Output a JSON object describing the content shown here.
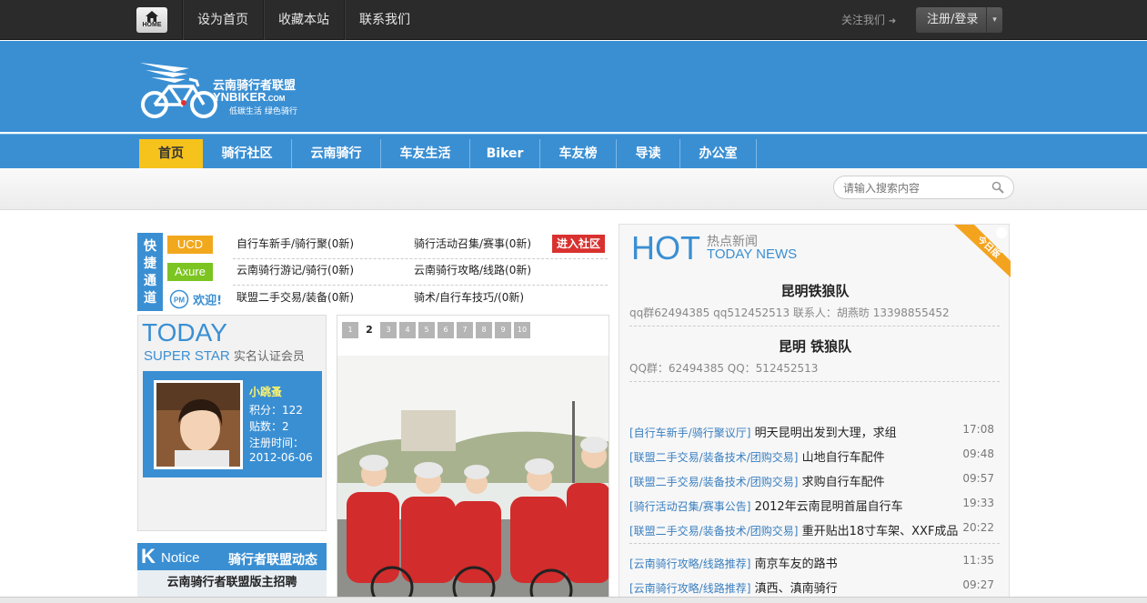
{
  "topbar": {
    "home_label": "HOME",
    "links": [
      "设为首页",
      "收藏本站",
      "联系我们"
    ],
    "follow": "关注我们",
    "login": "注册/登录"
  },
  "logo": {
    "cn": "云南骑行者联盟",
    "en": "YNBIKER",
    "en_suffix": ".COM",
    "slogan": "低碳生活 绿色骑行"
  },
  "nav": [
    "首页",
    "骑行社区",
    "云南骑行",
    "车友生活",
    "Biker",
    "车友榜",
    "导读",
    "办公室"
  ],
  "search": {
    "placeholder": "请输入搜索内容"
  },
  "quick": {
    "label_chars": [
      "快",
      "捷",
      "通",
      "道"
    ],
    "tags": [
      "UCD",
      "Axure"
    ],
    "pm": "欢迎!",
    "links": [
      "自行车新手/骑行聚(0新)",
      "骑行活动召集/赛事(0新)",
      "云南骑行游记/骑行(0新)",
      "云南骑行攻略/线路(0新)",
      "联盟二手交易/装备(0新)",
      "骑术/自行车技巧/(0新)"
    ],
    "enter": "进入社区"
  },
  "today": {
    "title": "TODAY",
    "subtitle": "SUPER STAR",
    "subtitle_cn": "实名认证会员",
    "name": "小跳蚤",
    "points": "积分：122",
    "posts": "贴数：2",
    "reg_label": "注册时间：",
    "reg_date": "2012-06-06"
  },
  "notice": {
    "k": "K",
    "title": "Notice",
    "title_cn": "骑行者联盟动态",
    "item": "云南骑行者联盟版主招聘"
  },
  "slider": {
    "pages": [
      "1",
      "2",
      "3",
      "4",
      "5",
      "6",
      "7",
      "8",
      "9",
      "10"
    ],
    "current": "2"
  },
  "hot": {
    "hot": "HOT",
    "cn": "热点新闻",
    "en": "TODAY NEWS",
    "ribbon": "今日版",
    "head1": "昆明铁狼队",
    "sub1": "qq群62494385 qq512452513 联系人：胡燕昉 13398855452",
    "head2": "昆明 铁狼队",
    "sub2": "QQ群：62494385 QQ：512452513",
    "news": [
      {
        "cat": "[自行车新手/骑行聚议厅]",
        "title": "明天昆明出发到大理，求组",
        "time": "17:08"
      },
      {
        "cat": "[联盟二手交易/装备技术/团购交易]",
        "title": "山地自行车配件",
        "time": "09:48"
      },
      {
        "cat": "[联盟二手交易/装备技术/团购交易]",
        "title": "求购自行车配件",
        "time": "09:57"
      },
      {
        "cat": "[骑行活动召集/赛事公告]",
        "title": "2012年云南昆明首届自行车",
        "time": "19:33"
      },
      {
        "cat": "[联盟二手交易/装备技术/团购交易]",
        "title": "重开贴出18寸车架、XXF成品",
        "time": "20:22"
      },
      {
        "cat": "[云南骑行攻略/线路推荐]",
        "title": "南京车友的路书",
        "time": "11:35"
      },
      {
        "cat": "[云南骑行攻略/线路推荐]",
        "title": "滇西、滇南骑行",
        "time": "09:27"
      }
    ]
  }
}
